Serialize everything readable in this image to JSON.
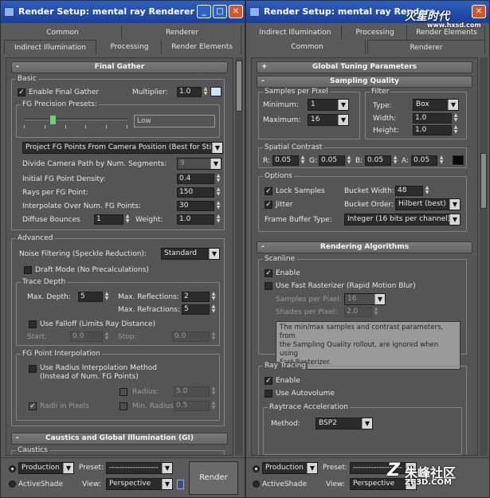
{
  "left_window": {
    "title": "Render Setup: mental ray Renderer",
    "tabs_row1": [
      "Common",
      "Renderer"
    ],
    "tabs_row2": [
      "Indirect Illumination",
      "Processing",
      "Render Elements"
    ],
    "final_gather_rollout": "Final Gather",
    "basic": {
      "title": "Basic",
      "enable_final_gather": "Enable Final Gather",
      "multiplier_label": "Multiplier:",
      "multiplier_value": "1.0",
      "multiplier_color": "#c9e6ff",
      "fg_presets_label": "FG Precision Presets:",
      "fg_preset_value": "Low",
      "projection_mode": "Project FG Points From Camera Position (Best for Stills)",
      "divide_label": "Divide Camera Path by Num. Segments:",
      "divide_value": "9",
      "initial_density_label": "Initial FG Point Density:",
      "initial_density_value": "0.4",
      "rays_label": "Rays per FG Point:",
      "rays_value": "150",
      "interpolate_label": "Interpolate Over Num. FG Points:",
      "interpolate_value": "30",
      "diffuse_label": "Diffuse Bounces",
      "diffuse_value": "1",
      "weight_label": "Weight:",
      "weight_value": "1.0"
    },
    "advanced": {
      "title": "Advanced",
      "noise_label": "Noise Filtering (Speckle Reduction):",
      "noise_value": "Standard",
      "draft_mode": "Draft Mode (No Precalculations)",
      "trace_depth": "Trace Depth",
      "max_depth_label": "Max. Depth:",
      "max_depth_value": "5",
      "max_reflections_label": "Max. Reflections:",
      "max_reflections_value": "2",
      "max_refractions_label": "Max. Refractions:",
      "max_refractions_value": "5",
      "use_falloff": "Use Falloff (Limits Ray Distance)",
      "start_label": "Start:",
      "start_value": "0.0",
      "stop_label": "Stop:",
      "stop_value": "0.0",
      "fg_interp": "FG Point Interpolation",
      "use_radius_line1": "Use Radius Interpolation Method",
      "use_radius_line2": "(Instead of Num. FG Points)",
      "radius_label": "Radius:",
      "radius_value": "5.0",
      "radii_pixels": "Radii in Pixels",
      "min_radius_label": "Min. Radius:",
      "min_radius_value": "0.5"
    },
    "caustics_rollout": "Caustics and Global Illumination (GI)",
    "caustics_group": "Caustics",
    "bottom": {
      "production": "Production",
      "activeshade": "ActiveShade",
      "preset_label": "Preset:",
      "preset_value": "-------------------",
      "view_label": "View:",
      "view_value": "Perspective",
      "render_button": "Render"
    }
  },
  "right_window": {
    "title": "Render Setup: mental ray Rendere",
    "tabs_row1": [
      "Indirect Illumination",
      "Processing",
      "Render Elements"
    ],
    "tabs_row2": [
      "Common",
      "Renderer"
    ],
    "global_tuning": "Global Tuning Parameters",
    "sampling_quality": "Sampling Quality",
    "samples_per_pixel": "Samples per Pixel",
    "minimum_label": "Minimum:",
    "minimum_value": "1",
    "maximum_label": "Maximum:",
    "maximum_value": "16",
    "filter": "Filter",
    "type_label": "Type:",
    "type_value": "Box",
    "width_label": "Width:",
    "width_value": "1.0",
    "height_label": "Height:",
    "height_value": "1.0",
    "spatial_contrast": "Spatial Contrast",
    "r_label": "R:",
    "r_value": "0.05",
    "g_label": "G:",
    "g_value": "0.05",
    "b_label": "B:",
    "b_value": "0.05",
    "a_label": "A:",
    "a_value": "0.05",
    "contrast_color": "#0a0a0a",
    "options": "Options",
    "lock_samples": "Lock Samples",
    "bucket_width_label": "Bucket Width:",
    "bucket_width_value": "48",
    "jitter": "Jitter",
    "bucket_order_label": "Bucket Order:",
    "bucket_order_value": "Hilbert (best)",
    "frame_buffer_label": "Frame Buffer Type:",
    "frame_buffer_value": "Integer (16 bits per channel)",
    "rendering_algorithms": "Rendering Algorithms",
    "scanline": "Scanline",
    "enable": "Enable",
    "use_fast_rasterizer": "Use Fast Rasterizer (Rapid Motion Blur)",
    "samples_per_pixel_label": "Samples per Pixel:",
    "samples_per_pixel_value": "16",
    "shades_per_pixel_label": "Shades per Pixel:",
    "shades_per_pixel_value": "2.0",
    "note_line1": "The min/max samples and contrast parameters, from",
    "note_line2": "the Sampling Quality rollout, are ignored when using",
    "note_line3": "Fast Rasterizer.",
    "ray_tracing": "Ray Tracing",
    "rt_enable": "Enable",
    "use_autovolume": "Use Autovolume",
    "raytrace_acceleration": "Raytrace Acceleration",
    "method_label": "Method:",
    "method_value": "BSP2",
    "bottom": {
      "production": "Production",
      "activeshade": "ActiveShade",
      "preset_label": "Preset:",
      "preset_value": "-------------------",
      "view_label": "View:",
      "view_value": "Perspective"
    }
  },
  "watermark_top": "www.hxsd.com",
  "watermark_bottom_cn": "朱峰社区",
  "watermark_bottom_url": "ZF3D.COM"
}
